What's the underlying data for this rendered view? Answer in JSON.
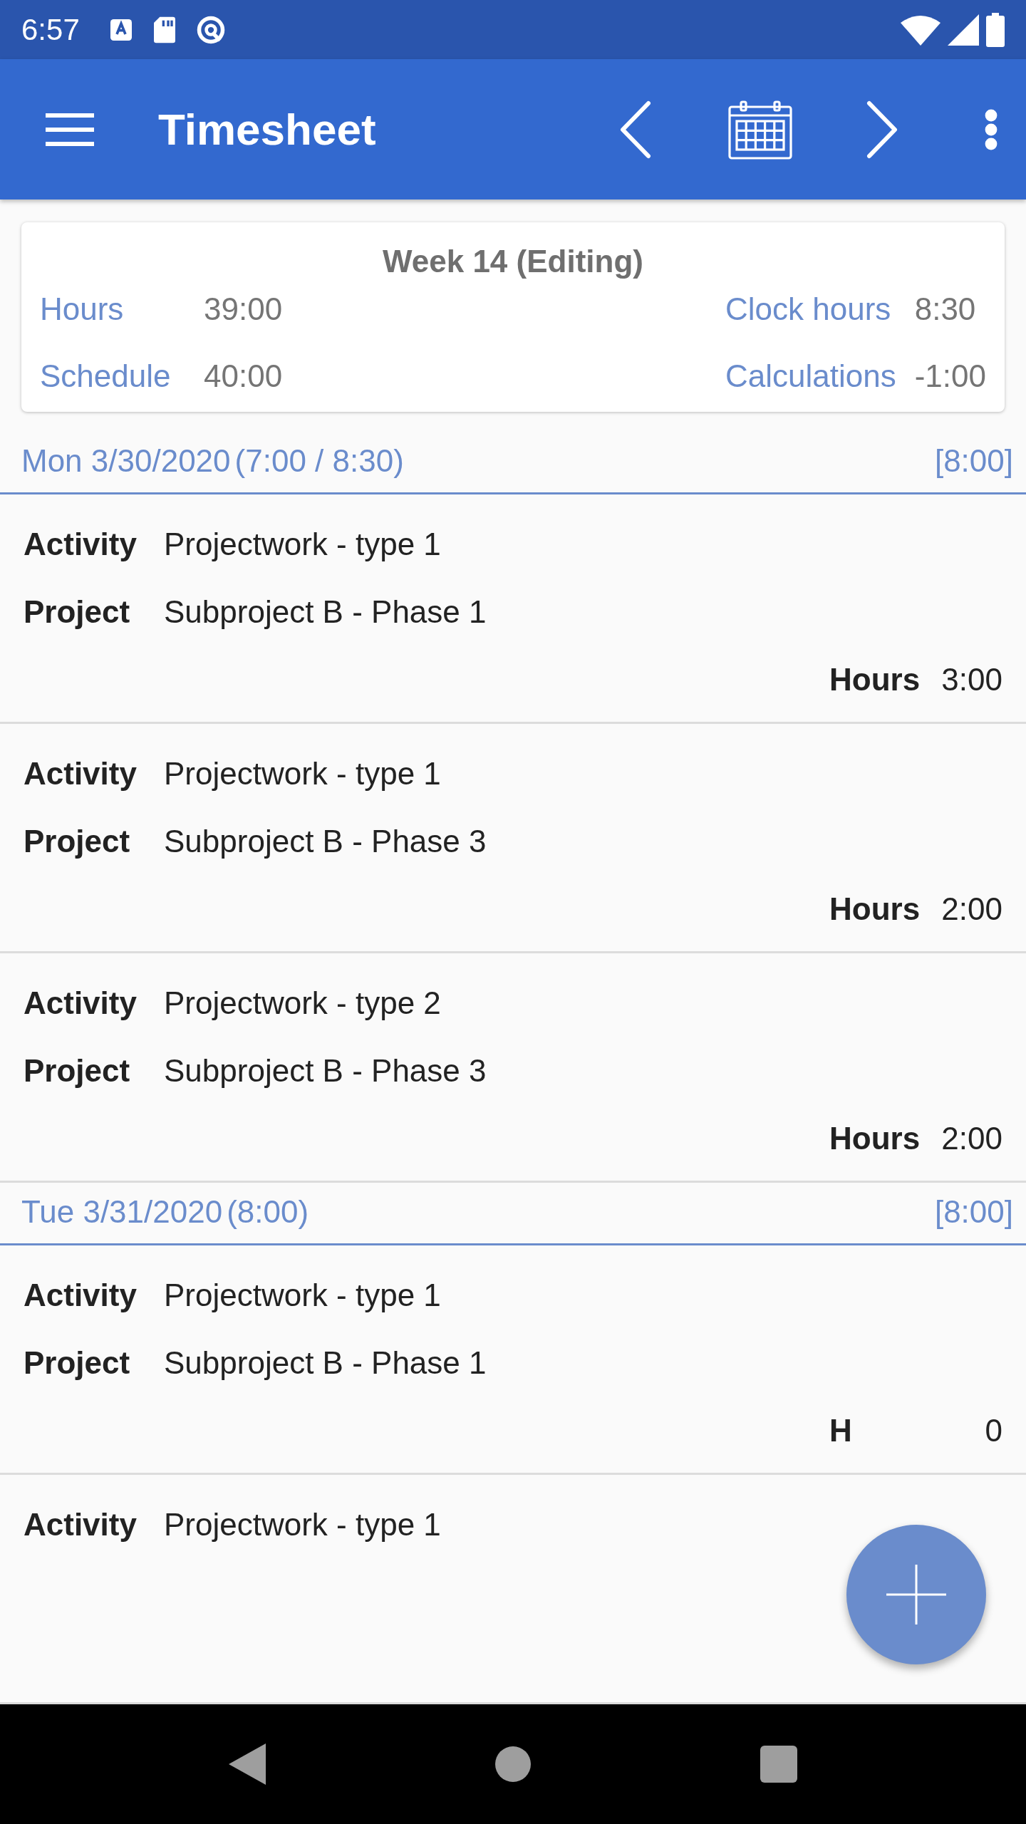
{
  "status_bar": {
    "time": "6:57"
  },
  "app_bar": {
    "title": "Timesheet"
  },
  "summary": {
    "title": "Week 14 (Editing)",
    "fields": [
      {
        "label": "Hours",
        "value": "39:00"
      },
      {
        "label": "Clock hours",
        "value": "8:30"
      },
      {
        "label": "Schedule",
        "value": "40:00"
      },
      {
        "label": "Calculations",
        "value": "-1:00"
      }
    ]
  },
  "days": [
    {
      "date": "Mon 3/30/2020",
      "times": "(7:00 / 8:30)",
      "total": "[8:00]",
      "entries": [
        {
          "activity_label": "Activity",
          "activity": "Projectwork - type 1",
          "project_label": "Project",
          "project": "Subproject B - Phase 1",
          "hours_label": "Hours",
          "hours": "3:00"
        },
        {
          "activity_label": "Activity",
          "activity": "Projectwork - type 1",
          "project_label": "Project",
          "project": "Subproject B - Phase 3",
          "hours_label": "Hours",
          "hours": "2:00"
        },
        {
          "activity_label": "Activity",
          "activity": "Projectwork - type 2",
          "project_label": "Project",
          "project": "Subproject B - Phase 3",
          "hours_label": "Hours",
          "hours": "2:00"
        }
      ]
    },
    {
      "date": "Tue 3/31/2020",
      "times": "(8:00)",
      "total": "[8:00]",
      "entries": [
        {
          "activity_label": "Activity",
          "activity": "Projectwork - type 1",
          "project_label": "Project",
          "project": "Subproject B - Phase 1",
          "hours_label": "H",
          "hours": "0"
        },
        {
          "activity_label": "Activity",
          "activity": "Projectwork - type 1"
        }
      ]
    }
  ]
}
